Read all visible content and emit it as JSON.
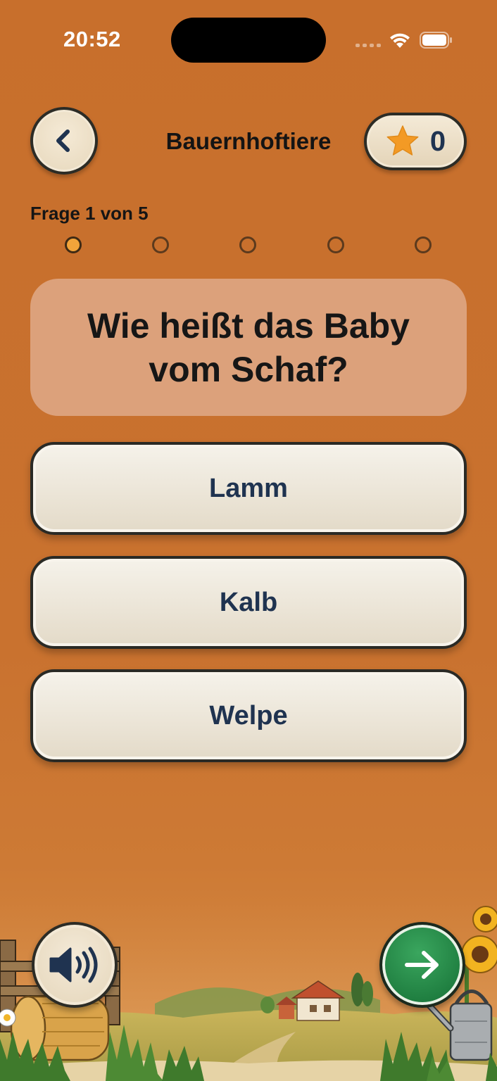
{
  "status_bar": {
    "time": "20:52"
  },
  "header": {
    "title": "Bauernhoftiere",
    "back_icon": "chevron-left-icon",
    "score": "0",
    "score_icon": "star-icon"
  },
  "progress": {
    "label": "Frage 1 von 5",
    "total": 5,
    "current": 1
  },
  "question": {
    "text": "Wie heißt das Baby vom Schaf?"
  },
  "answers": [
    {
      "label": "Lamm"
    },
    {
      "label": "Kalb"
    },
    {
      "label": "Welpe"
    }
  ],
  "footer": {
    "sound_icon": "speaker-icon",
    "next_icon": "arrow-right-icon"
  },
  "colors": {
    "background": "#c9702d",
    "question_card": "#dca17b",
    "answer_text": "#1f3350",
    "star": "#f39a25",
    "next_button": "#1f7e40",
    "active_dot": "#f2a43a"
  }
}
